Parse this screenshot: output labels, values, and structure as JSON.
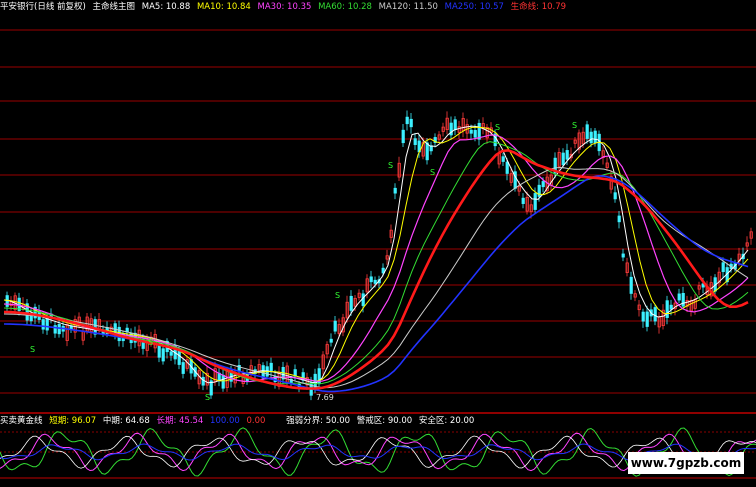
{
  "main_legend": {
    "title": "平安银行(日线 前复权)",
    "indicator": "主命线主图",
    "ma5": "MA5: 10.88",
    "ma10": "MA10: 10.84",
    "ma30": "MA30: 10.35",
    "ma60": "MA60: 10.28",
    "ma120": "MA120: 11.50",
    "ma250": "MA250: 10.57",
    "lifeline": "生命线: 10.79"
  },
  "sub_legend": {
    "title": "买卖黄金线",
    "short": "短期: 96.07",
    "mid": "中期: 64.68",
    "long": "长期: 45.54",
    "v1": "100.00",
    "v2": "0.00",
    "strong_weak": "强弱分界: 50.00",
    "alert": "警戒区: 90.00",
    "safe": "安全区: 20.00"
  },
  "low_price": "7.69",
  "watermark": "www.7gpzb.com",
  "colors": {
    "up": "#ff3b3b",
    "down": "#3cf0ff",
    "ma5": "#ffffff",
    "ma10": "#ffff00",
    "ma30": "#ff44ff",
    "ma60": "#33dd33",
    "ma120": "#cccccc",
    "ma250": "#2233ff",
    "lifeline": "#ff1a1a",
    "grid": "#b00000"
  }
}
